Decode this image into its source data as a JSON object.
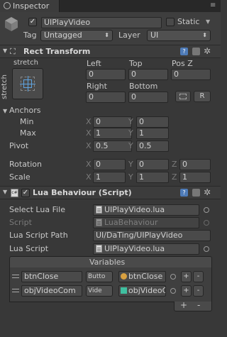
{
  "window": {
    "tab_title": "Inspector"
  },
  "object": {
    "name": "UIPlayVideo",
    "static_label": "Static",
    "tag_label": "Tag",
    "tag_value": "Untagged",
    "layer_label": "Layer",
    "layer_value": "UI"
  },
  "rect_transform": {
    "title": "Rect Transform",
    "anchor_preset": "stretch",
    "anchor_side": "stretch",
    "col_headers": [
      "Left",
      "Top",
      "Pos Z"
    ],
    "row1": [
      "0",
      "0",
      "0"
    ],
    "col_headers2": [
      "Right",
      "Bottom"
    ],
    "row2": [
      "0",
      "0"
    ],
    "r_button": "R",
    "anchors_label": "Anchors",
    "min_label": "Min",
    "min": {
      "x": "0",
      "y": "0"
    },
    "max_label": "Max",
    "max": {
      "x": "1",
      "y": "1"
    },
    "pivot_label": "Pivot",
    "pivot": {
      "x": "0.5",
      "y": "0.5"
    },
    "rotation_label": "Rotation",
    "rotation": {
      "x": "0",
      "y": "0",
      "z": "0"
    },
    "scale_label": "Scale",
    "scale": {
      "x": "1",
      "y": "1",
      "z": "1"
    }
  },
  "lua": {
    "title": "Lua Behaviour (Script)",
    "select_label": "Select Lua File",
    "select_value": "UIPlayVideo.lua",
    "script_label": "Script",
    "script_value": "LuaBehaviour",
    "path_label": "Lua Script Path",
    "path_value": "UI/DaTing/UIPlayVideo",
    "lua_script_label": "Lua Script",
    "lua_script_value": "UIPlayVideo.lua",
    "variables_title": "Variables",
    "variables": [
      {
        "name": "btnClose",
        "type": "Butto",
        "ref": "btnClose"
      },
      {
        "name": "objVideoCom",
        "type": "Vide",
        "ref": "objVideoC"
      }
    ],
    "plus": "+",
    "minus": "-"
  },
  "axis": {
    "x": "X",
    "y": "Y",
    "z": "Z"
  }
}
